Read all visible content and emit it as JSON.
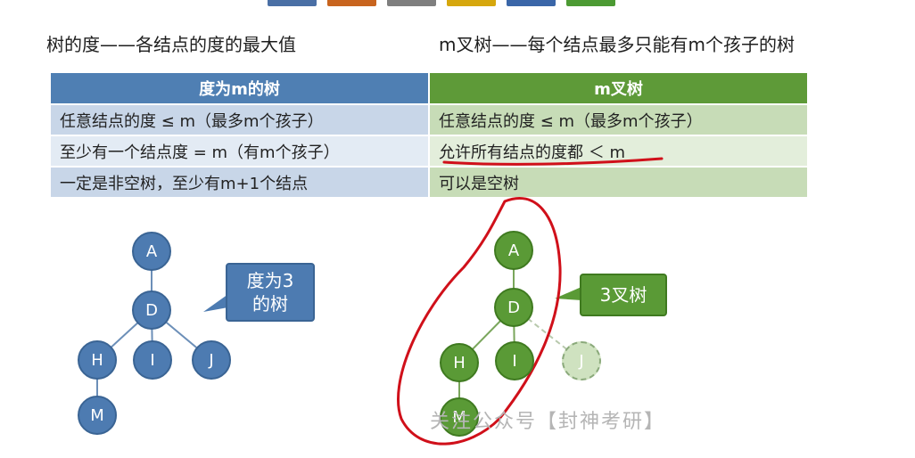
{
  "toolbar_colors": [
    "#4a6fa5",
    "#c8641e",
    "#7f7f7f",
    "#d6a70d",
    "#3a66a8",
    "#4c9a33"
  ],
  "headings": {
    "left": "树的度——各结点的度的最大值",
    "right": "m叉树——每个结点最多只能有m个孩子的树"
  },
  "table": {
    "headers": [
      "度为m的树",
      "m叉树"
    ],
    "rows": [
      [
        "任意结点的度 ≤ m（最多m个孩子）",
        "任意结点的度 ≤ m（最多m个孩子）"
      ],
      [
        "至少有一个结点度 = m（有m个孩子）",
        "允许所有结点的度都 ＜ m"
      ],
      [
        "一定是非空树，至少有m+1个结点",
        "可以是空树"
      ]
    ]
  },
  "tree_left": {
    "nodes": [
      "A",
      "D",
      "H",
      "I",
      "J",
      "M"
    ],
    "callout": [
      "度为3",
      "的树"
    ],
    "color": "#4d7bb1"
  },
  "tree_right": {
    "nodes": [
      "A",
      "D",
      "H",
      "I",
      "J",
      "M"
    ],
    "ghost_node": "J",
    "callout": "3叉树",
    "color": "#5a9a36"
  },
  "watermark": "关注公众号【封神考研】",
  "annotation_color": "#d0101a"
}
